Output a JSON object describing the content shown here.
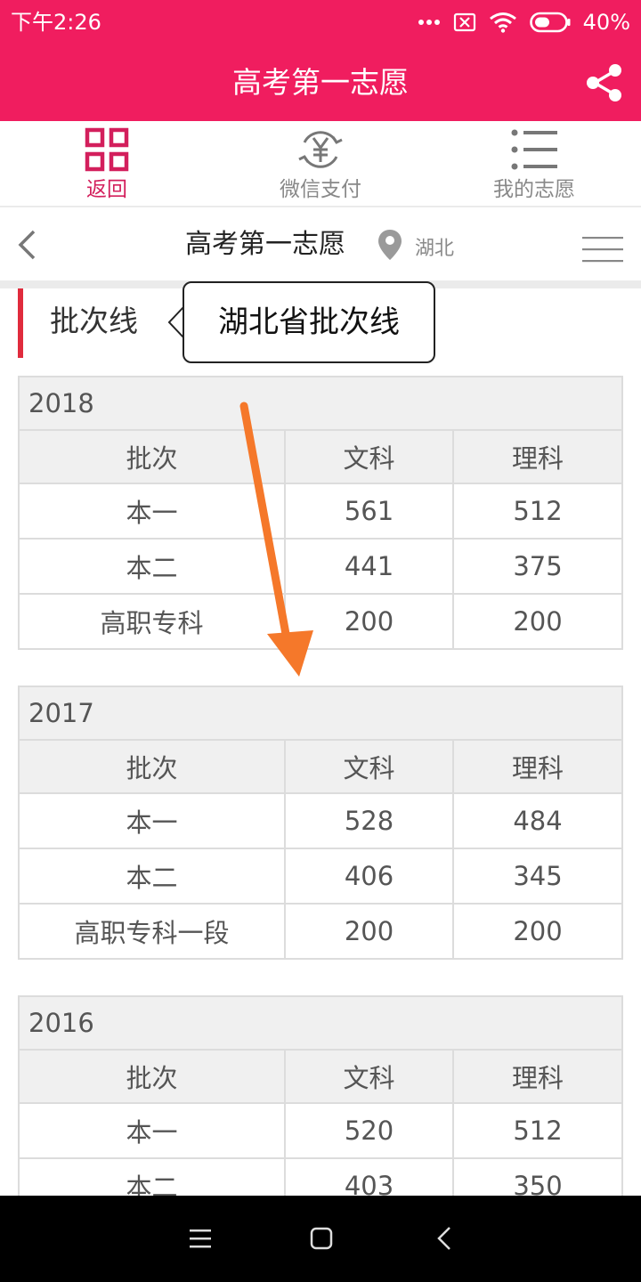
{
  "status_bar": {
    "time": "下午2:26",
    "battery": "40%",
    "icons": [
      "more-dots-icon",
      "sim-off-icon",
      "wifi-icon",
      "battery-icon"
    ]
  },
  "app_header": {
    "title": "高考第一志愿",
    "share_icon": "share-icon"
  },
  "tabs": [
    {
      "label": "返回",
      "icon": "grid-icon",
      "active": true
    },
    {
      "label": "微信支付",
      "icon": "yuan-cycle-icon",
      "active": false
    },
    {
      "label": "我的志愿",
      "icon": "list-icon",
      "active": false
    }
  ],
  "sub_nav": {
    "title": "高考第一志愿",
    "location": "湖北"
  },
  "section": {
    "title": "批次线",
    "callout": "湖北省批次线"
  },
  "tables": [
    {
      "year": "2018",
      "headers": [
        "批次",
        "文科",
        "理科"
      ],
      "rows": [
        [
          "本一",
          "561",
          "512"
        ],
        [
          "本二",
          "441",
          "375"
        ],
        [
          "高职专科",
          "200",
          "200"
        ]
      ]
    },
    {
      "year": "2017",
      "headers": [
        "批次",
        "文科",
        "理科"
      ],
      "rows": [
        [
          "本一",
          "528",
          "484"
        ],
        [
          "本二",
          "406",
          "345"
        ],
        [
          "高职专科一段",
          "200",
          "200"
        ]
      ]
    },
    {
      "year": "2016",
      "headers": [
        "批次",
        "文科",
        "理科"
      ],
      "rows": [
        [
          "本一",
          "520",
          "512"
        ],
        [
          "本二",
          "403",
          "350"
        ]
      ]
    }
  ],
  "colors": {
    "brand": "#f01d5f",
    "active_tab": "#d31f5c",
    "section_mark": "#e02b3d",
    "arrow": "#f5782a"
  }
}
